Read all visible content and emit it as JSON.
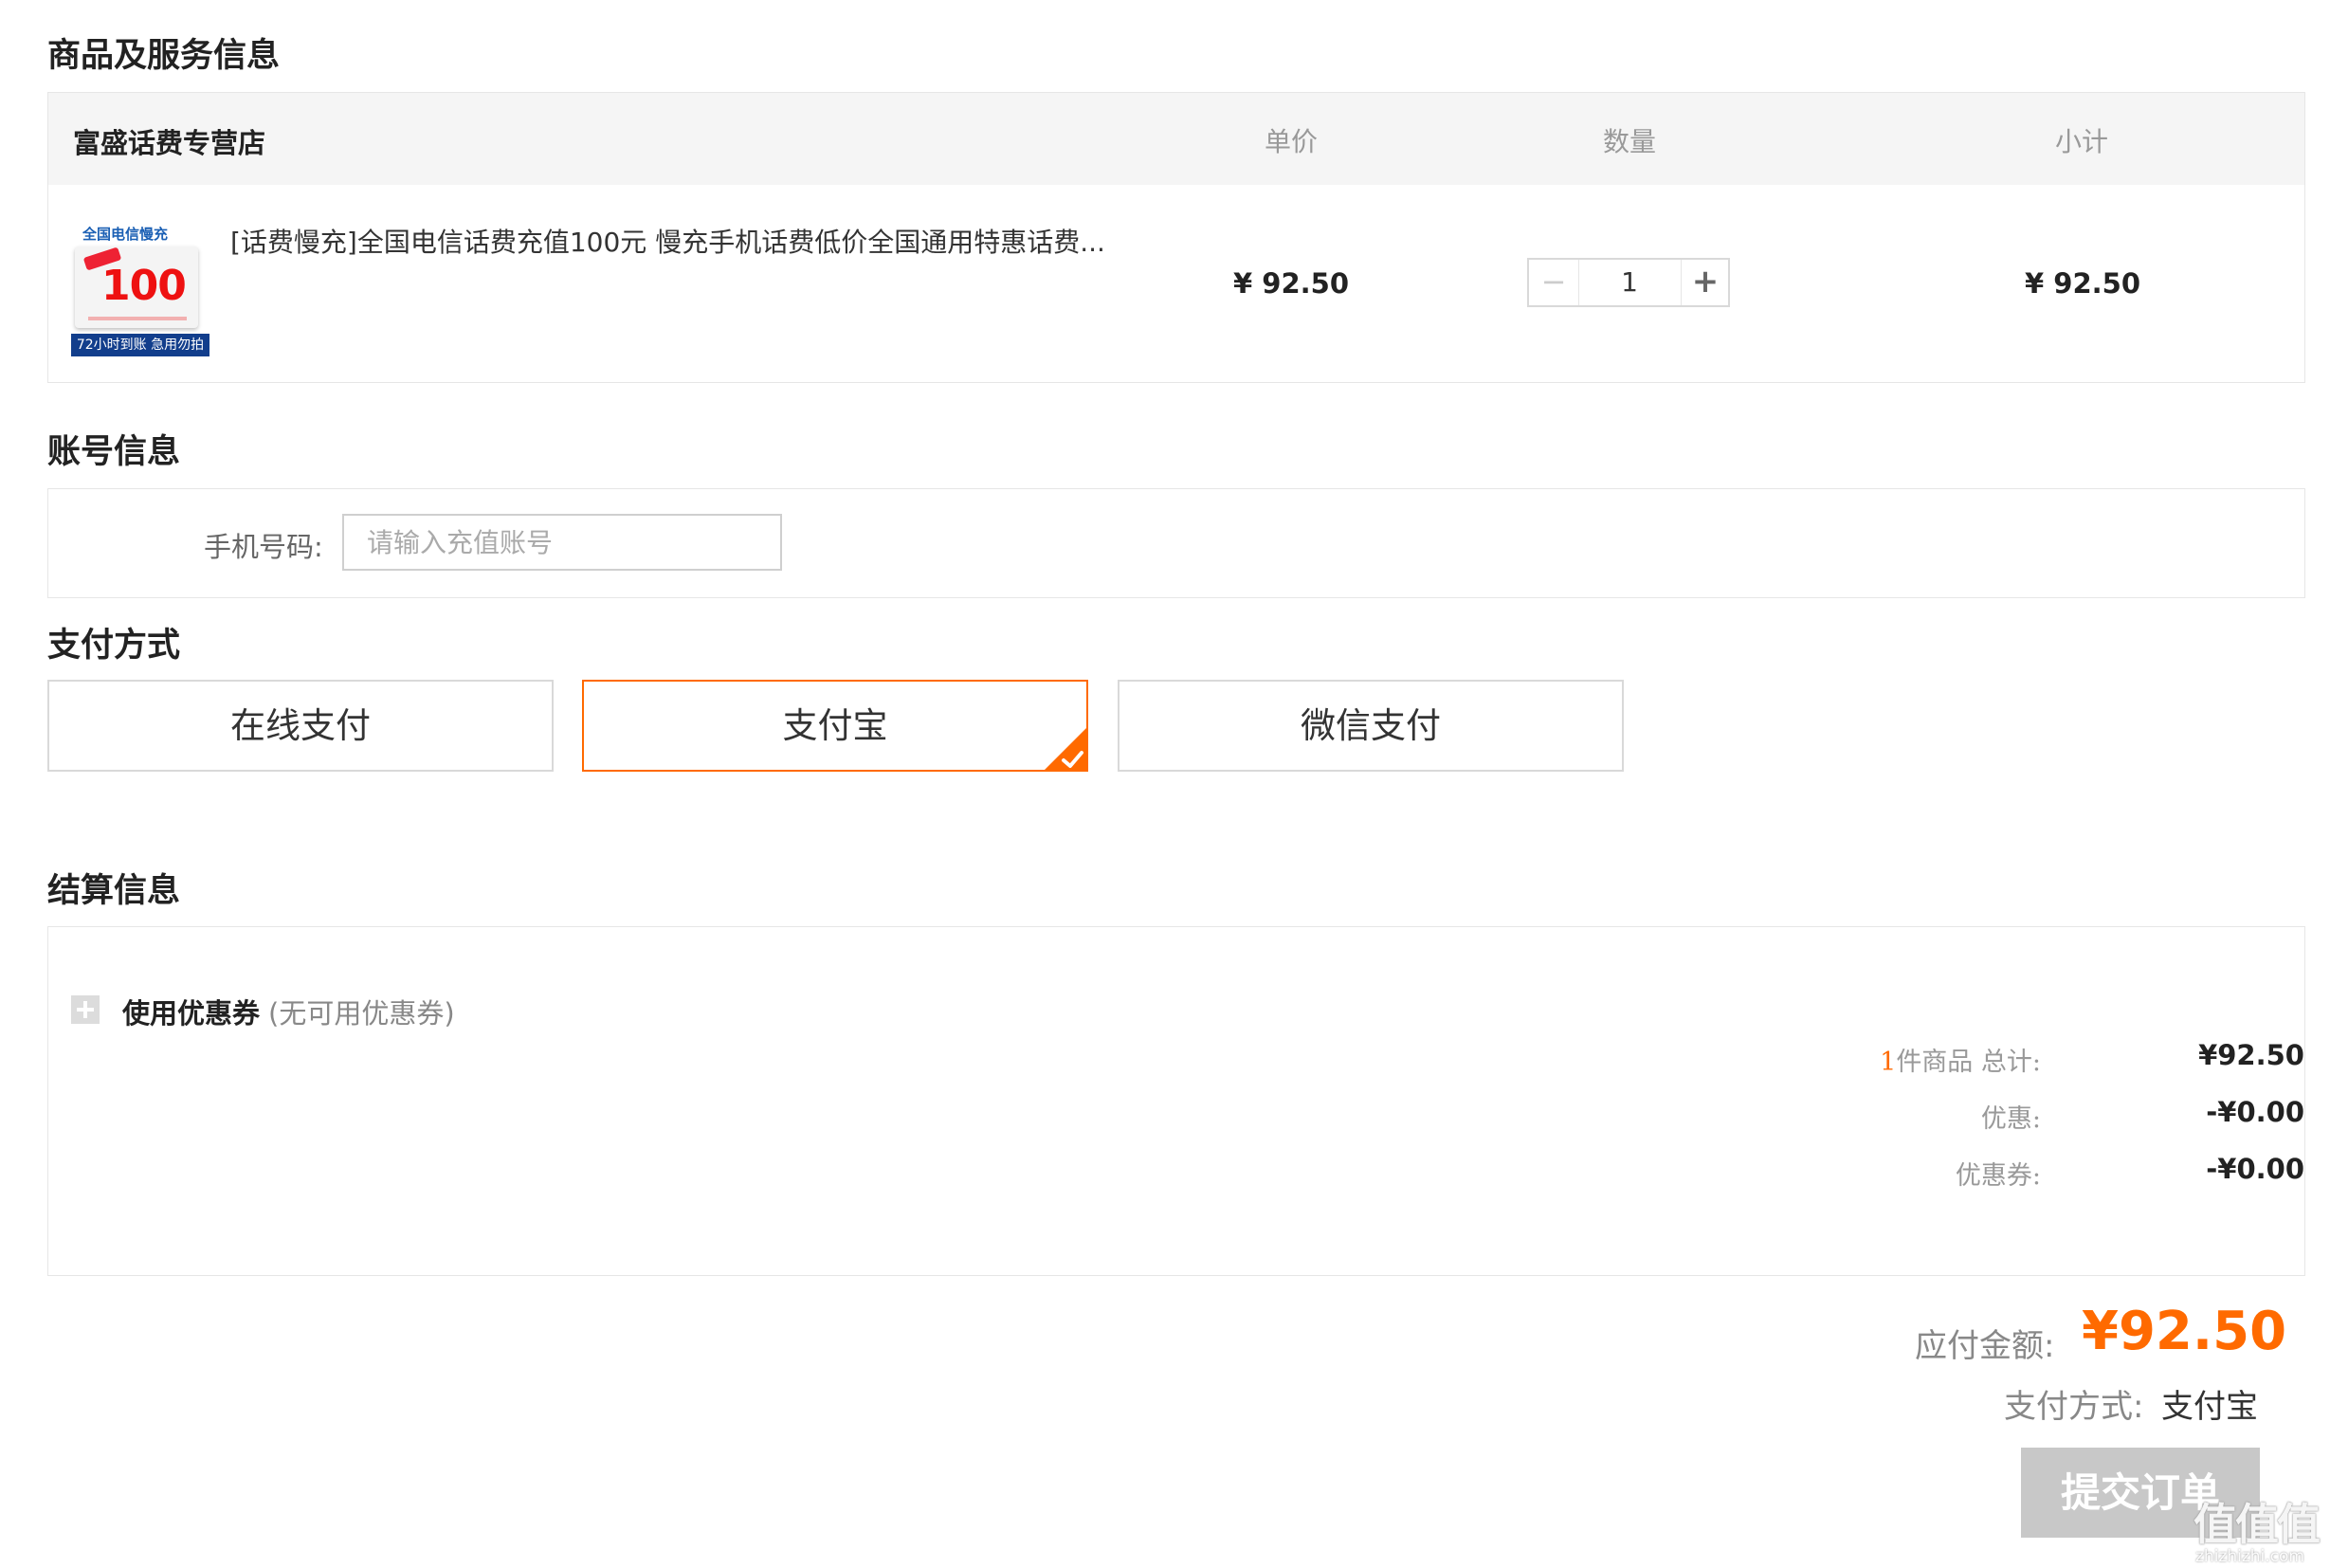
{
  "sections": {
    "goods_title": "商品及服务信息",
    "account_title": "账号信息",
    "payment_title": "支付方式",
    "settlement_title": "结算信息"
  },
  "product_table": {
    "store_name": "富盛话费专营店",
    "headers": {
      "unit_price": "单价",
      "quantity": "数量",
      "subtotal": "小计"
    },
    "item": {
      "thumb_brand": "全国电信慢充",
      "thumb_value": "100",
      "thumb_strip": "72小时到账 急用勿拍",
      "name": "[话费慢充]全国电信话费充值100元 慢充手机话费低价全国通用特惠话费...",
      "unit_price": "¥ 92.50",
      "quantity": "1",
      "subtotal": "¥ 92.50",
      "minus_symbol": "−",
      "plus_symbol": "+"
    }
  },
  "account": {
    "phone_label": "手机号码:",
    "phone_placeholder": "请输入充值账号",
    "phone_value": ""
  },
  "payment": {
    "options": [
      "在线支付",
      "支付宝",
      "微信支付"
    ],
    "selected": "支付宝"
  },
  "settlement": {
    "coupon_label": "使用优惠券",
    "coupon_note": "(无可用优惠券)",
    "item_count": "1",
    "total_label": "件商品  总计:",
    "total_value": "¥92.50",
    "discount_label": "优惠:",
    "discount_value": "-¥0.00",
    "coupon_discount_label": "优惠券:",
    "coupon_discount_value": "-¥0.00"
  },
  "footer": {
    "payable_label": "应付金额:",
    "payable_amount": "¥92.50",
    "paymethod_label": "支付方式:",
    "paymethod_value": "支付宝",
    "submit_label": "提交订单"
  },
  "watermark": {
    "text": "值值值",
    "sub": "zhizhizhi.com"
  },
  "colors": {
    "accent": "#ff6a00",
    "border": "#e6e6e6",
    "header_bg": "#f5f5f5",
    "disabled_button": "#c8c8c8"
  },
  "icons": {
    "selected_corner": "check-icon",
    "coupon_toggle": "plus-icon"
  }
}
